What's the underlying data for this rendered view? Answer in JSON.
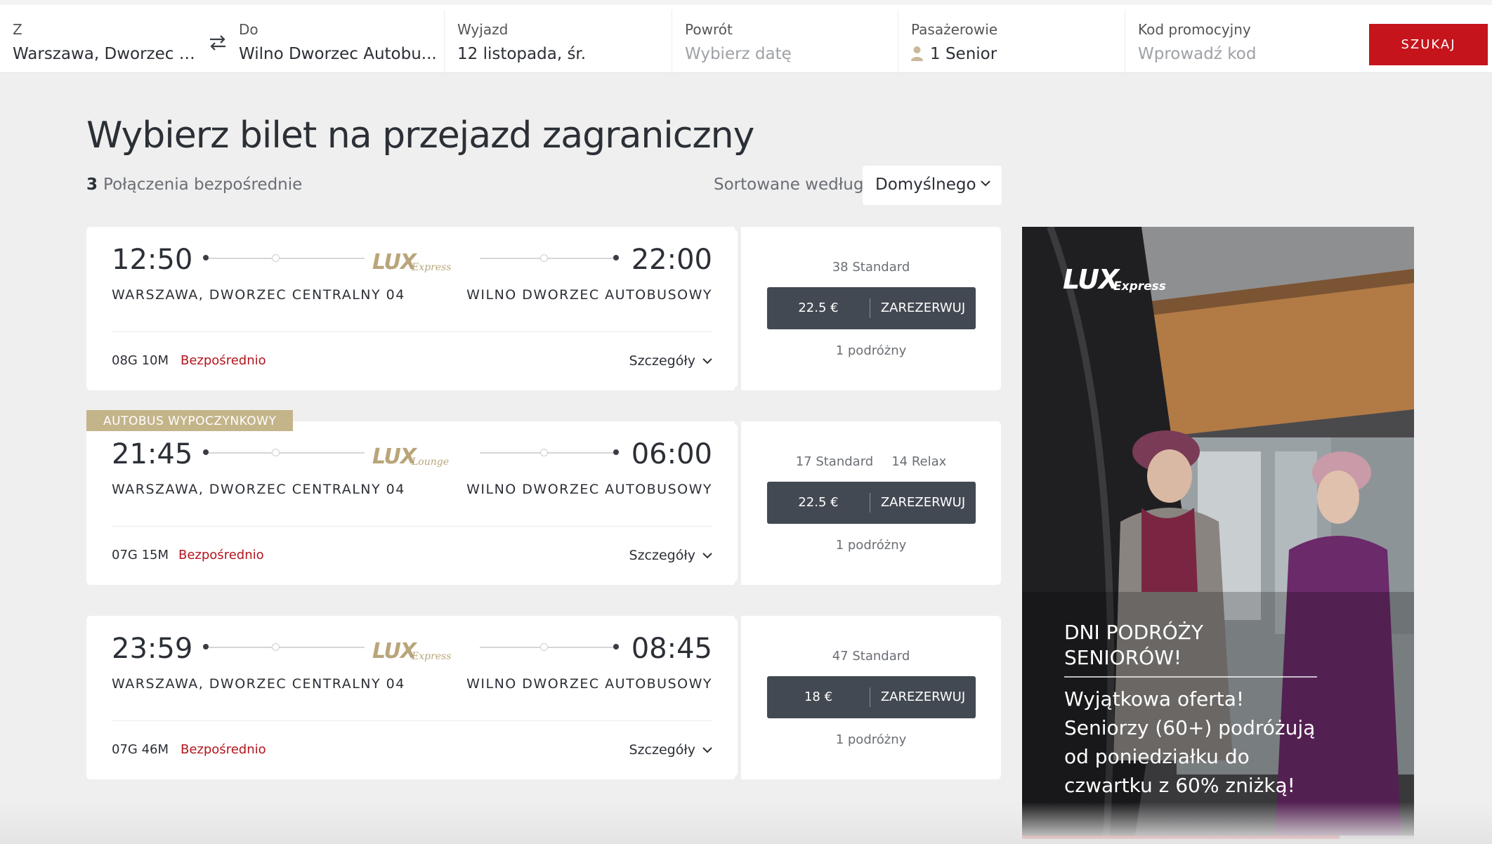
{
  "search": {
    "from_label": "Z",
    "from_value": "Warszawa, Dworzec C...",
    "to_label": "Do",
    "to_value": "Wilno Dworzec Autobu...",
    "depart_label": "Wyjazd",
    "depart_value": "12 listopada, śr.",
    "return_label": "Powrót",
    "return_placeholder": "Wybierz datę",
    "passengers_label": "Pasażerowie",
    "passengers_value": "1 Senior",
    "promo_label": "Kod promocyjny",
    "promo_placeholder": "Wprowadź kod",
    "search_button": "SZUKAJ"
  },
  "results": {
    "title": "Wybierz bilet na przejazd zagraniczny",
    "count": "3",
    "count_label": "Połączenia bezpośrednie",
    "sort_label": "Sortowane według",
    "sort_value": "Domyślnego"
  },
  "trips": [
    {
      "tag": "",
      "departure_time": "12:50",
      "arrival_time": "22:00",
      "brand": "LUX",
      "brand_sub": "Express",
      "from_station": "WARSZAWA, DWORZEC CENTRALNY 04",
      "to_station": "WILNO DWORZEC AUTOBUSOWY",
      "duration": "08G 10M",
      "direct": "Bezpośrednio",
      "details": "Szczegóły",
      "seats": [
        "38 Standard"
      ],
      "price": "22.5 €",
      "book": "ZAREZERWUJ",
      "passengers": "1 podróżny"
    },
    {
      "tag": "AUTOBUS WYPOCZYNKOWY",
      "departure_time": "21:45",
      "arrival_time": "06:00",
      "brand": "LUX",
      "brand_sub": "Lounge",
      "from_station": "WARSZAWA, DWORZEC CENTRALNY 04",
      "to_station": "WILNO DWORZEC AUTOBUSOWY",
      "duration": "07G 15M",
      "direct": "Bezpośrednio",
      "details": "Szczegóły",
      "seats": [
        "17 Standard",
        "14 Relax"
      ],
      "price": "22.5 €",
      "book": "ZAREZERWUJ",
      "passengers": "1 podróżny"
    },
    {
      "tag": "",
      "departure_time": "23:59",
      "arrival_time": "08:45",
      "brand": "LUX",
      "brand_sub": "Express",
      "from_station": "WARSZAWA, DWORZEC CENTRALNY 04",
      "to_station": "WILNO DWORZEC AUTOBUSOWY",
      "duration": "07G 46M",
      "direct": "Bezpośrednio",
      "details": "Szczegóły",
      "seats": [
        "47 Standard"
      ],
      "price": "18 €",
      "book": "ZAREZERWUJ",
      "passengers": "1 podróżny"
    }
  ],
  "promo": {
    "brand": "LUX",
    "brand_sub": "Express",
    "title_line1": "DNI PODRÓŻY",
    "title_line2": "SENIORÓW!",
    "text": "Wyjątkowa oferta! Seniorzy (60+) podróżują od poniedziałku do czwartku z 60% zniżką!",
    "carousel_progress": 0.81
  },
  "colors": {
    "accent": "#c5141b",
    "button_dark": "#434952",
    "brand_gold": "#b9a57a",
    "tag_gold": "#c4b48a"
  },
  "icons": [
    "swap-icon",
    "person-icon",
    "chevron-down-icon"
  ]
}
